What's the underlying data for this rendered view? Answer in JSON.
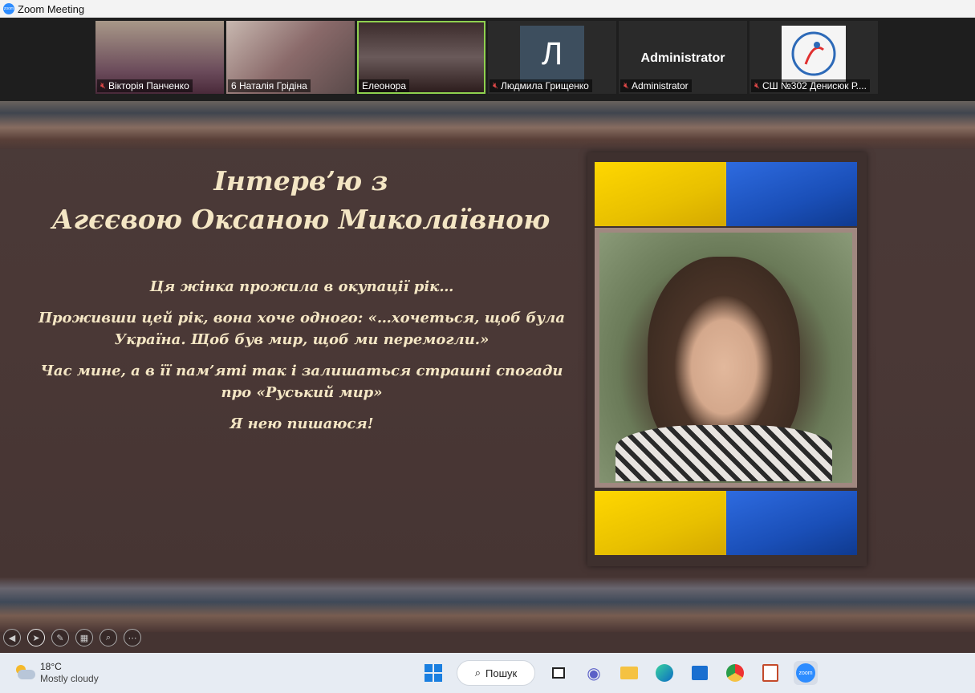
{
  "window": {
    "title": "Zoom Meeting",
    "logo_text": "zoom"
  },
  "participants": [
    {
      "name": "Вікторія Панченко",
      "muted": true
    },
    {
      "name": "6 Наталія Грідіна",
      "muted": false
    },
    {
      "name": "Елеонора",
      "muted": false,
      "active": true
    },
    {
      "name": "Людмила Грищенко",
      "muted": true,
      "avatar_letter": "Л"
    },
    {
      "name": "Administrator",
      "muted": true,
      "display_text": "Administrator"
    },
    {
      "name": "СШ №302 Денисюк Р....",
      "muted": true
    }
  ],
  "slide": {
    "title_line1": "Інтерв’ю з",
    "title_line2": "Агєєвою Оксаною Миколаївною",
    "para1": "Ця жінка прожила в окупації рік…",
    "para2": "Проживши цей рік, вона хоче одного: «…хочеться, щоб була Україна. Щоб був мир, щоб ми перемогли.»",
    "para3": "Час мине, а в її пам’яті так і залишаться страшні спогади про «Руський мир»",
    "para4": "Я нею пишаюся!"
  },
  "slide_controls": [
    "prev-icon",
    "pointer-icon",
    "pen-icon",
    "slides-icon",
    "zoom-icon",
    "more-icon"
  ],
  "taskbar": {
    "weather_temp": "18°C",
    "weather_condition": "Mostly cloudy",
    "search_label": "Пошук",
    "zoom_label": "zoom"
  },
  "colors": {
    "accent": "#2d8cff",
    "slide_text": "#f4e6c4",
    "active_border": "#8fd14f",
    "muted_mic": "#e04848"
  }
}
